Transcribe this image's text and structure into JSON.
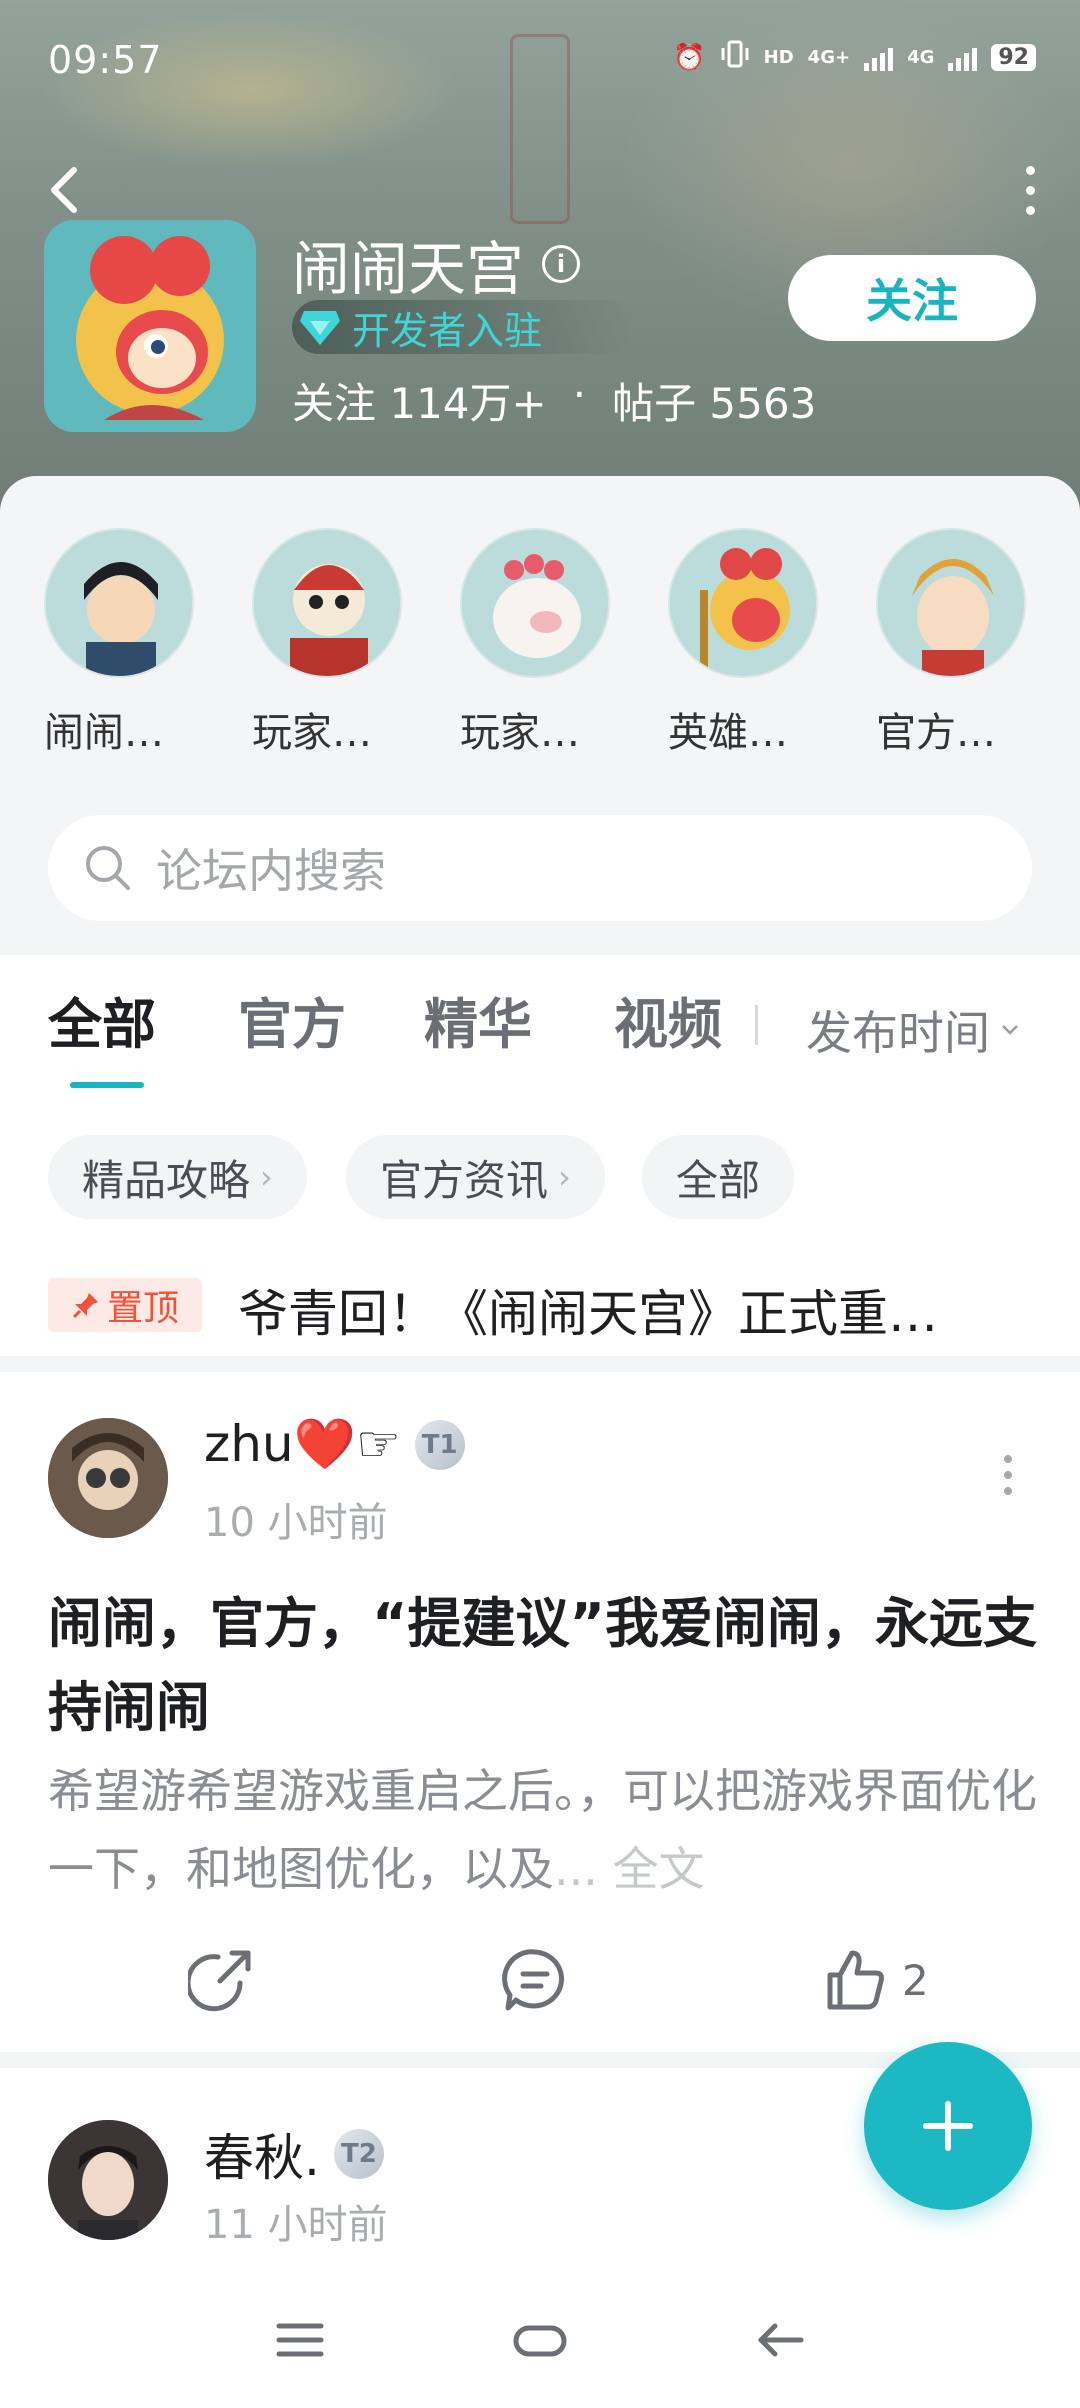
{
  "status_bar": {
    "time": "09:57",
    "hd_label": "HD",
    "network_1": "4G+",
    "network_2": "4G",
    "battery": "92"
  },
  "header": {
    "game_title": "闹闹天宫",
    "developer_badge": "开发者入驻",
    "follow_count_label": "关注 114万+",
    "separator": "·",
    "post_count_label": "帖子 5563",
    "follow_button": "关注"
  },
  "character_channels": [
    {
      "label": "闹闹…",
      "icon": "character-avatar-scholar"
    },
    {
      "label": "玩家…",
      "icon": "character-avatar-masked-warrior"
    },
    {
      "label": "玩家…",
      "icon": "character-avatar-pig"
    },
    {
      "label": "英雄…",
      "icon": "character-avatar-monkey-king"
    },
    {
      "label": "官方…",
      "icon": "character-avatar-general"
    }
  ],
  "search": {
    "placeholder": "论坛内搜索"
  },
  "tabs": {
    "items": [
      "全部",
      "官方",
      "精华",
      "视频"
    ],
    "active_index": 0,
    "sort_label": "发布时间"
  },
  "chips": [
    "精品攻略",
    "官方资讯",
    "全部"
  ],
  "pinned": {
    "badge": "置顶",
    "text": "爷青回！《闹闹天宫》正式重…"
  },
  "posts": [
    {
      "username": "zhu❤️☞",
      "level": "T1",
      "time": "10 小时前",
      "title": "闹闹，官方，“提建议”我爱闹闹，永远支持闹闹",
      "body": "希望游希望游戏重启之后。，可以把游戏界面优化一下，和地图优化，以及",
      "more_label": "... 全文",
      "like_count": "2"
    },
    {
      "username": "春秋.",
      "level": "T2",
      "time": "11 小时前"
    }
  ],
  "colors": {
    "accent": "#1cb8c4",
    "pin_red": "#f0533a",
    "header_bg": "#7f8f87"
  }
}
